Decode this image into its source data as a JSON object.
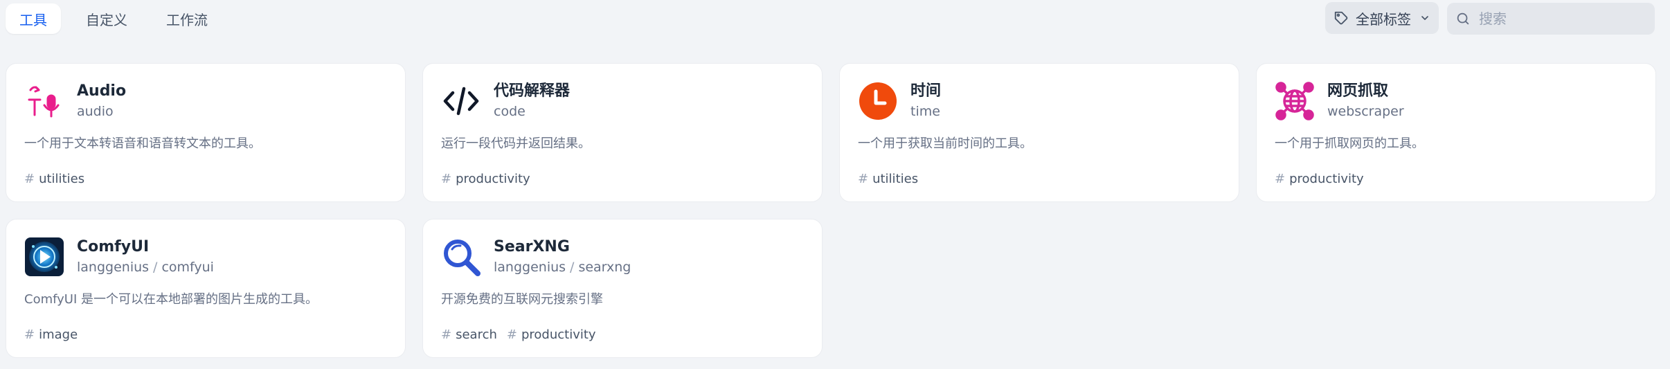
{
  "tabs": [
    {
      "label": "工具",
      "active": true
    },
    {
      "label": "自定义",
      "active": false
    },
    {
      "label": "工作流",
      "active": false
    }
  ],
  "filter": {
    "label": "全部标签"
  },
  "search": {
    "placeholder": "搜索"
  },
  "colors": {
    "accent": "#155eef",
    "audio_icon": "#e91e8c",
    "time_icon": "#f04a0c",
    "webscraper_icon": "#d62598",
    "searxng_icon": "#3056d3"
  },
  "cards": [
    {
      "icon": "microphone-speech-icon",
      "name": "Audio",
      "org": "",
      "id": "audio",
      "desc": "一个用于文本转语音和语音转文本的工具。",
      "tags": [
        "utilities"
      ]
    },
    {
      "icon": "code-brackets-icon",
      "name": "代码解释器",
      "org": "",
      "id": "code",
      "desc": "运行一段代码并返回结果。",
      "tags": [
        "productivity"
      ]
    },
    {
      "icon": "clock-icon",
      "name": "时间",
      "org": "",
      "id": "time",
      "desc": "一个用于获取当前时间的工具。",
      "tags": [
        "utilities"
      ]
    },
    {
      "icon": "globe-network-icon",
      "name": "网页抓取",
      "org": "",
      "id": "webscraper",
      "desc": "一个用于抓取网页的工具。",
      "tags": [
        "productivity"
      ]
    },
    {
      "icon": "comfyui-logo-icon",
      "name": "ComfyUI",
      "org": "langgenius",
      "id": "comfyui",
      "desc": "ComfyUI 是一个可以在本地部署的图片生成的工具。",
      "tags": [
        "image"
      ]
    },
    {
      "icon": "magnifier-icon",
      "name": "SearXNG",
      "org": "langgenius",
      "id": "searxng",
      "desc": "开源免费的互联网元搜索引擎",
      "tags": [
        "search",
        "productivity"
      ]
    }
  ]
}
